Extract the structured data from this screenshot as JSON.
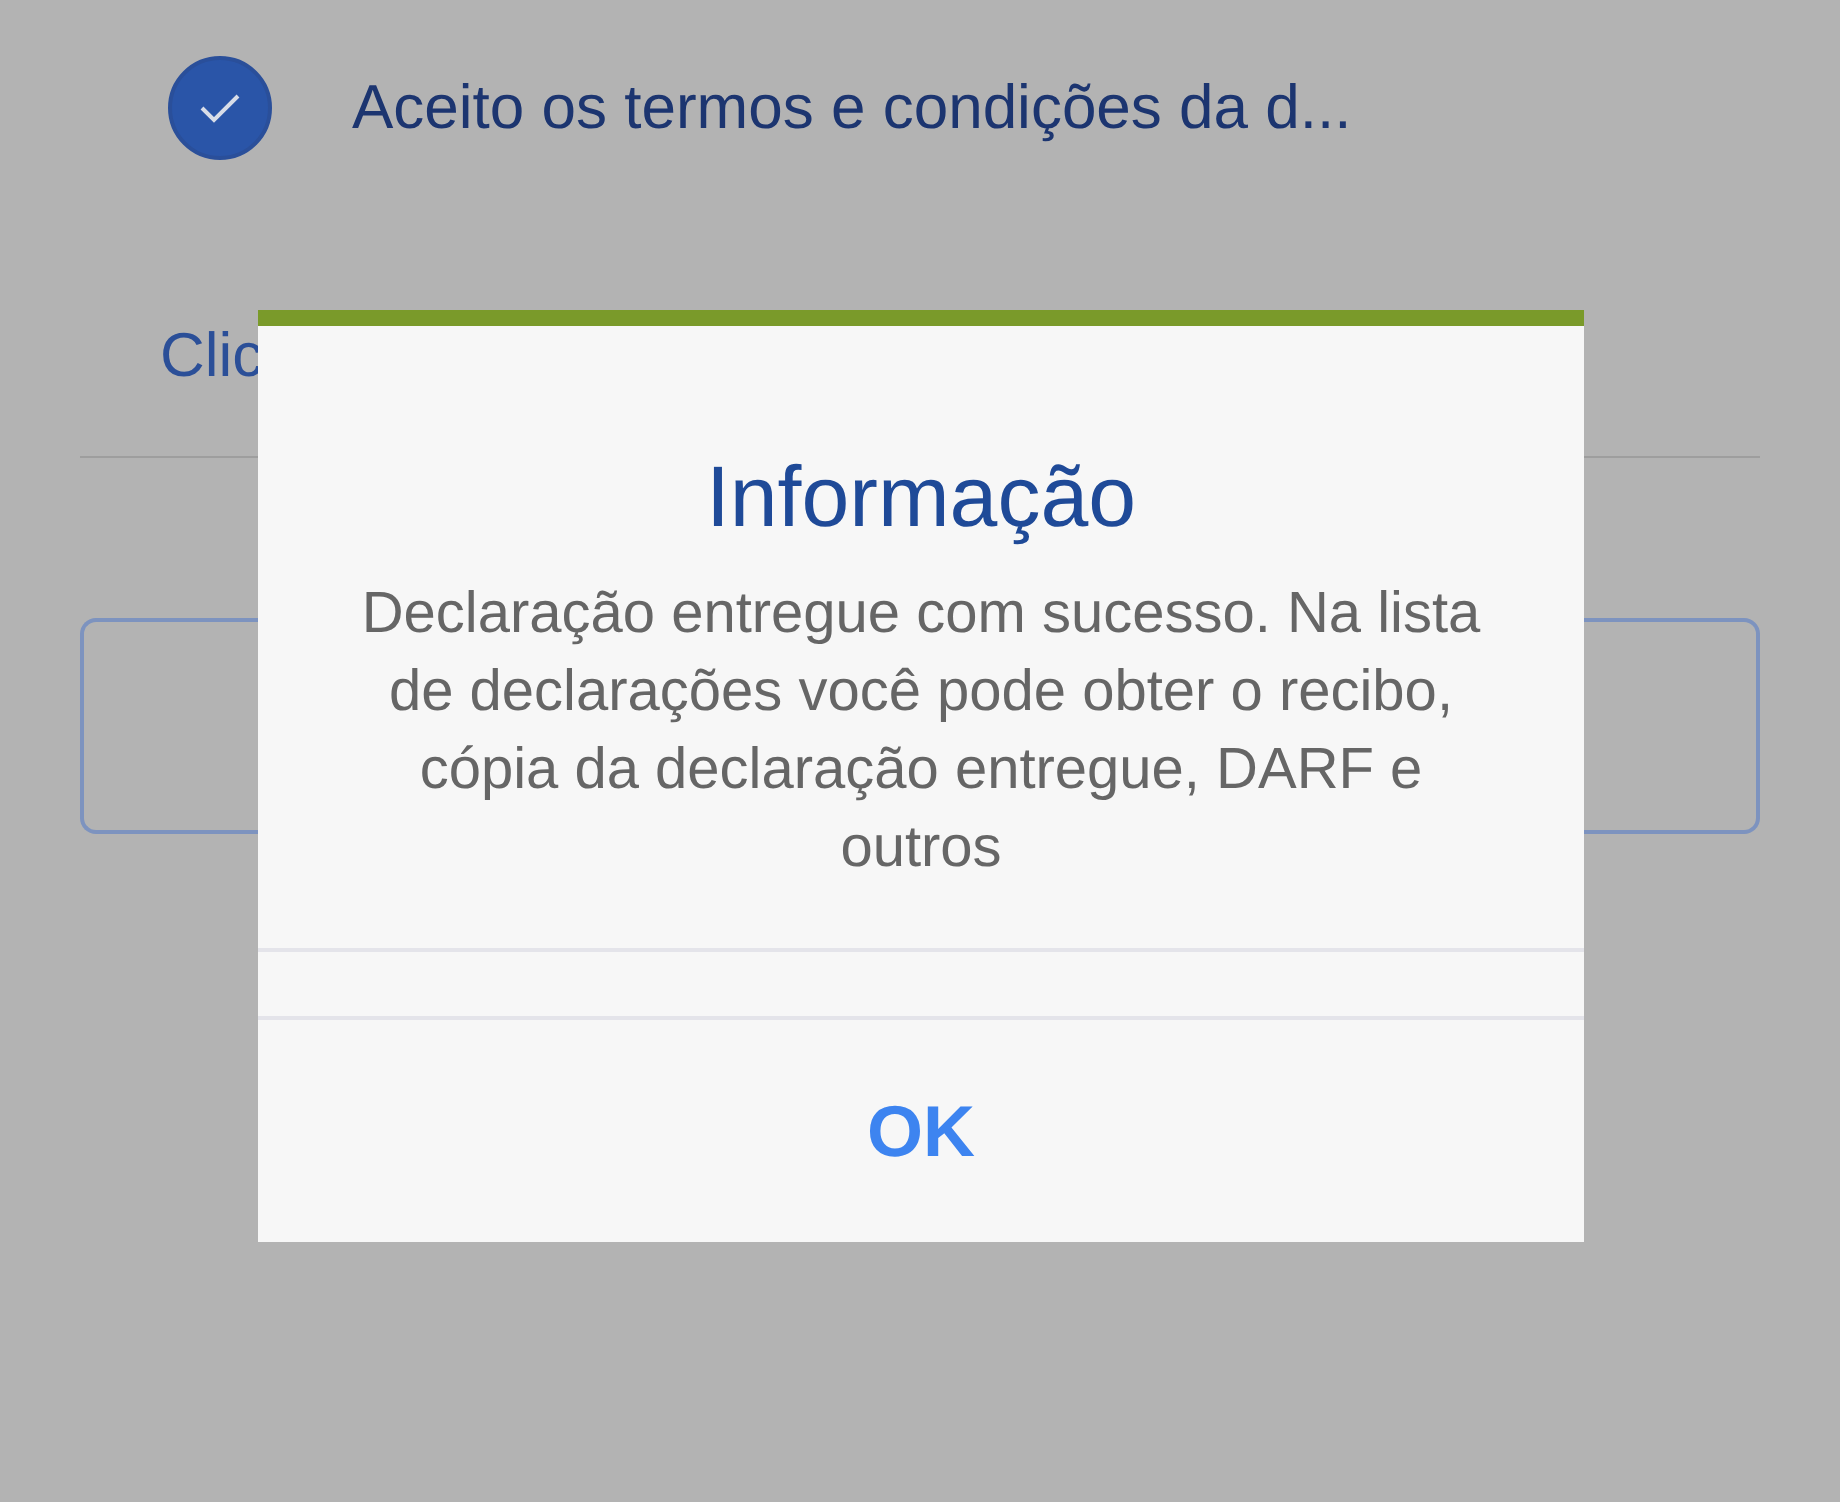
{
  "terms": {
    "label": "Aceito os termos e condições da d...",
    "checked": true
  },
  "link": {
    "label": "Clic"
  },
  "dialog": {
    "title": "Informação",
    "message": "Declaração entregue com sucesso. Na lista de declarações você pode obter o recibo, cópia da declaração entregue, DARF e outros",
    "button": "OK"
  }
}
